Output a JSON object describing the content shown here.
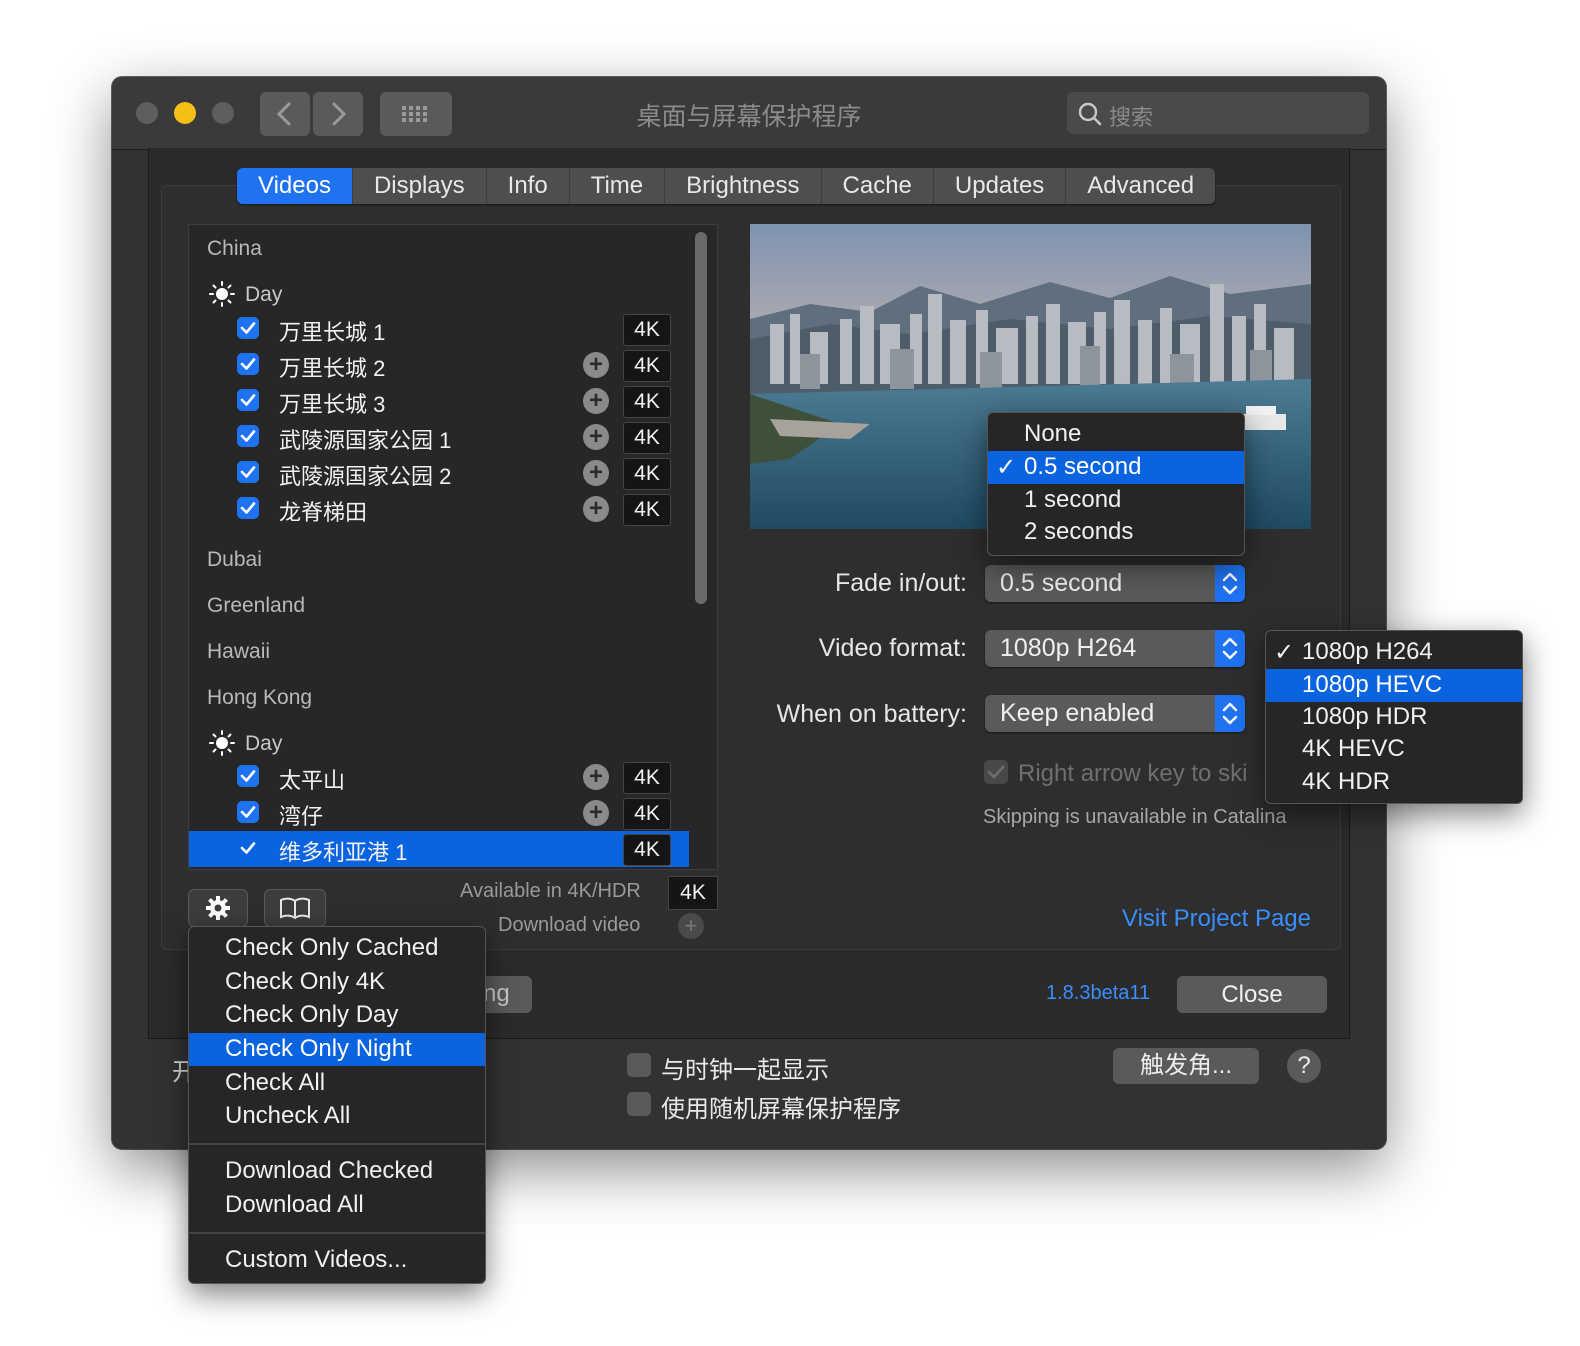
{
  "window": {
    "title": "桌面与屏幕保护程序",
    "search_placeholder": "搜索"
  },
  "tabs": [
    {
      "label": "Videos",
      "active": true
    },
    {
      "label": "Displays"
    },
    {
      "label": "Info"
    },
    {
      "label": "Time"
    },
    {
      "label": "Brightness"
    },
    {
      "label": "Cache"
    },
    {
      "label": "Updates"
    },
    {
      "label": "Advanced"
    }
  ],
  "video_list": {
    "groups": {
      "china": "China",
      "china_day": "Day",
      "dubai": "Dubai",
      "greenland": "Greenland",
      "hawaii": "Hawaii",
      "hong_kong": "Hong Kong",
      "hk_day": "Day"
    },
    "china_items": [
      {
        "label": "万里长城 1",
        "badge": "4K",
        "checked": true,
        "downloadable": false
      },
      {
        "label": "万里长城 2",
        "badge": "4K",
        "checked": true,
        "downloadable": true
      },
      {
        "label": "万里长城 3",
        "badge": "4K",
        "checked": true,
        "downloadable": true
      },
      {
        "label": "武陵源国家公园 1",
        "badge": "4K",
        "checked": true,
        "downloadable": true
      },
      {
        "label": "武陵源国家公园 2",
        "badge": "4K",
        "checked": true,
        "downloadable": true
      },
      {
        "label": "龙脊梯田",
        "badge": "4K",
        "checked": true,
        "downloadable": true
      }
    ],
    "hk_items": [
      {
        "label": "太平山",
        "badge": "4K",
        "checked": true,
        "downloadable": true
      },
      {
        "label": "湾仔",
        "badge": "4K",
        "checked": true,
        "downloadable": true
      },
      {
        "label": "维多利亚港 1",
        "badge": "4K",
        "checked": true,
        "selected": true
      }
    ],
    "plus_glyph": "+"
  },
  "info": {
    "available_label": "Available in 4K/HDR",
    "available_badge": "4K",
    "download_label": "Download video",
    "download_glyph": "+"
  },
  "settings": {
    "fade_label": "Fade in/out:",
    "fade_value": "0.5 second",
    "format_label": "Video format:",
    "format_value": "1080p H264",
    "battery_label": "When on battery:",
    "battery_value": "Keep enabled",
    "arrow_key_text": "Right arrow key to ski",
    "skip_note": "Skipping is unavailable in Catalina",
    "visit_link": "Visit Project Page",
    "version": "1.8.3beta11",
    "close": "Close",
    "hidden_button_fragment": "ng"
  },
  "fade_menu": {
    "options": [
      "None",
      "0.5 second",
      "1 second",
      "2 seconds"
    ],
    "selected": "0.5 second",
    "check_glyph": "✓"
  },
  "format_menu": {
    "options": [
      "1080p H264",
      "1080p HEVC",
      "1080p HDR",
      "4K HEVC",
      "4K HDR"
    ],
    "checked": "1080p H264",
    "highlighted": "1080p HEVC",
    "check_glyph": "✓"
  },
  "gear_menu": {
    "group1": [
      "Check Only Cached",
      "Check Only 4K",
      "Check Only Day",
      "Check Only Night",
      "Check All",
      "Uncheck All"
    ],
    "highlighted": "Check Only Night",
    "group2": [
      "Download Checked",
      "Download All"
    ],
    "group3": [
      "Custom Videos..."
    ]
  },
  "lower": {
    "clock_option": "与时钟一起显示",
    "random_option": "使用随机屏幕保护程序",
    "hot_corners": "触发角...",
    "help": "?",
    "left_cut": "开"
  },
  "colors": {
    "accent": "#1f72f0",
    "highlight": "#0a64e0",
    "link": "#3a8dff",
    "window_bg": "#323232",
    "traffic_yellow": "#f5bf18"
  }
}
